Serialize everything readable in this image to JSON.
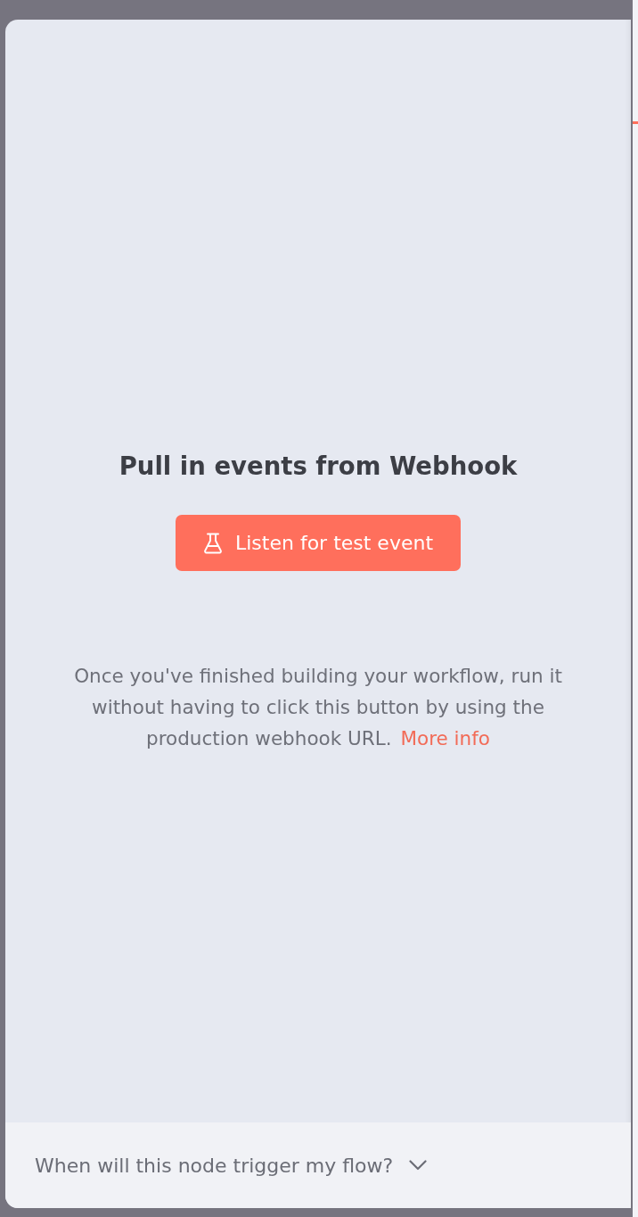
{
  "title": "Pull in events from Webhook",
  "listen_button": {
    "label": "Listen for test event"
  },
  "description": {
    "text": "Once you've finished building your workflow, run it without having to click this button by using the production webhook URL.",
    "link": "More info"
  },
  "footer": {
    "question": "When will this node trigger my flow?",
    "expanded": false
  }
}
